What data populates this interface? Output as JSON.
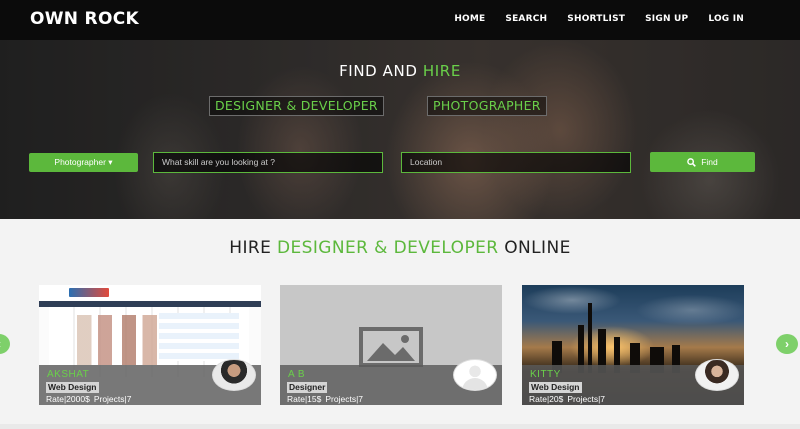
{
  "brand": "OWN ROCK",
  "nav": {
    "items": [
      "HOME",
      "SEARCH",
      "SHORTLIST",
      "SIGN UP",
      "LOG IN"
    ]
  },
  "hero": {
    "title_prefix": "FIND AND",
    "title_accent": "HIRE",
    "pills": [
      "DESIGNER & DEVELOPER",
      "PHOTOGRAPHER"
    ]
  },
  "search": {
    "category_label": "Photographer",
    "category_caret": "▾",
    "skill_placeholder": "What skill are you looking at ?",
    "location_placeholder": "Location",
    "find_label": "Find"
  },
  "section": {
    "title_prefix": "HIRE",
    "title_accent": "DESIGNER & DEVELOPER",
    "title_suffix": "ONLINE"
  },
  "carousel": {
    "prev_arrow": "‹",
    "next_arrow": "›"
  },
  "cards": [
    {
      "name": "AKSHAT",
      "tag": "Web Design",
      "rate": "Rate|2000$",
      "projects": "Projects|7"
    },
    {
      "name": "A B",
      "tag": "Designer",
      "rate": "Rate|15$",
      "projects": "Projects|7"
    },
    {
      "name": "KITTY",
      "tag": "Web Design",
      "rate": "Rate|20$",
      "projects": "Projects|7"
    }
  ],
  "colors": {
    "accent": "#5cb83c",
    "nav_bg": "#0b0b0b"
  }
}
